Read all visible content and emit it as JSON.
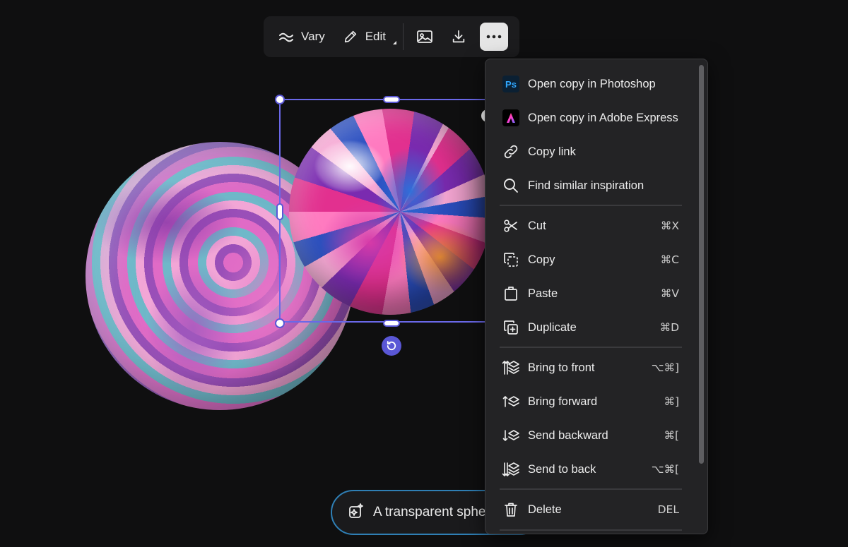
{
  "toolbar": {
    "vary_label": "Vary",
    "edit_label": "Edit",
    "icons": [
      "wave-icon",
      "pencil-icon",
      "image-icon",
      "download-icon",
      "more-icon"
    ]
  },
  "prompt": {
    "text": "A transparent spheri"
  },
  "menu": {
    "open_photoshop": {
      "label": "Open copy in Photoshop",
      "badge": "Ps"
    },
    "open_express": {
      "label": "Open copy in Adobe Express"
    },
    "copy_link": {
      "label": "Copy link"
    },
    "find_similar": {
      "label": "Find similar inspiration"
    },
    "cut": {
      "label": "Cut",
      "shortcut": "⌘X"
    },
    "copy": {
      "label": "Copy",
      "shortcut": "⌘C"
    },
    "paste": {
      "label": "Paste",
      "shortcut": "⌘V"
    },
    "duplicate": {
      "label": "Duplicate",
      "shortcut": "⌘D"
    },
    "bring_front": {
      "label": "Bring to front",
      "shortcut": "⌥⌘]"
    },
    "bring_forward": {
      "label": "Bring forward",
      "shortcut": "⌘]"
    },
    "send_backward": {
      "label": "Send backward",
      "shortcut": "⌘["
    },
    "send_back": {
      "label": "Send to back",
      "shortcut": "⌥⌘["
    },
    "delete": {
      "label": "Delete",
      "shortcut": "DEL"
    }
  },
  "colors": {
    "selection": "#6a68e8",
    "menu_bg": "#232325",
    "prompt_border": "#2f7fb5",
    "ps_blue": "#31a8ff"
  }
}
